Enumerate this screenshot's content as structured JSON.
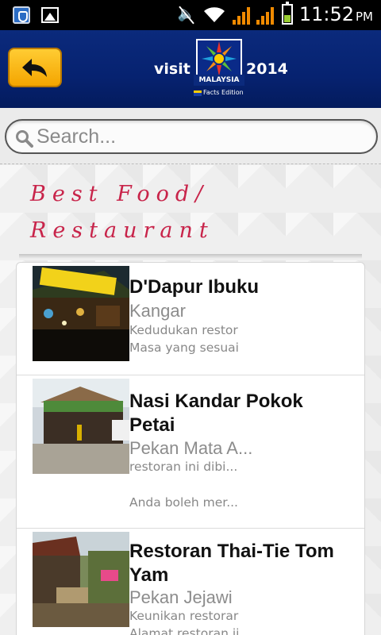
{
  "status_bar": {
    "time": "11:52",
    "ampm": "PM",
    "icons": [
      "app-notification-icon",
      "image-notification-icon",
      "mute-icon",
      "wifi-icon",
      "signal-icon",
      "signal-icon",
      "battery-icon"
    ],
    "battery_level": 0.4
  },
  "header": {
    "logo_visit": "visit",
    "logo_country": "MALAYSIA",
    "logo_year": "2014",
    "logo_edition": "Facts Edition",
    "back_icon": "back-arrow-icon",
    "color": "#062270"
  },
  "search": {
    "placeholder": "Search..."
  },
  "section": {
    "title_line1": "Best Food/",
    "title_line2": "Restaurant",
    "color": "#c8244a"
  },
  "restaurants": [
    {
      "title": "D'Dapur Ibuku",
      "city": "Kangar",
      "desc1": "Kedudukan restor",
      "desc2": "Masa yang sesuai"
    },
    {
      "title_line1": "Nasi Kandar Pokok",
      "title_line2": "Petai",
      "city": "Pekan Mata A...",
      "desc1": "restoran ini dibi...",
      "desc2": "Anda boleh mer..."
    },
    {
      "title_line1": "Restoran Thai-Tie Tom",
      "title_line2": "Yam",
      "city": "Pekan Jejawi",
      "desc1": "Keunikan restorar",
      "desc2": "Alamat restoran ii"
    }
  ]
}
